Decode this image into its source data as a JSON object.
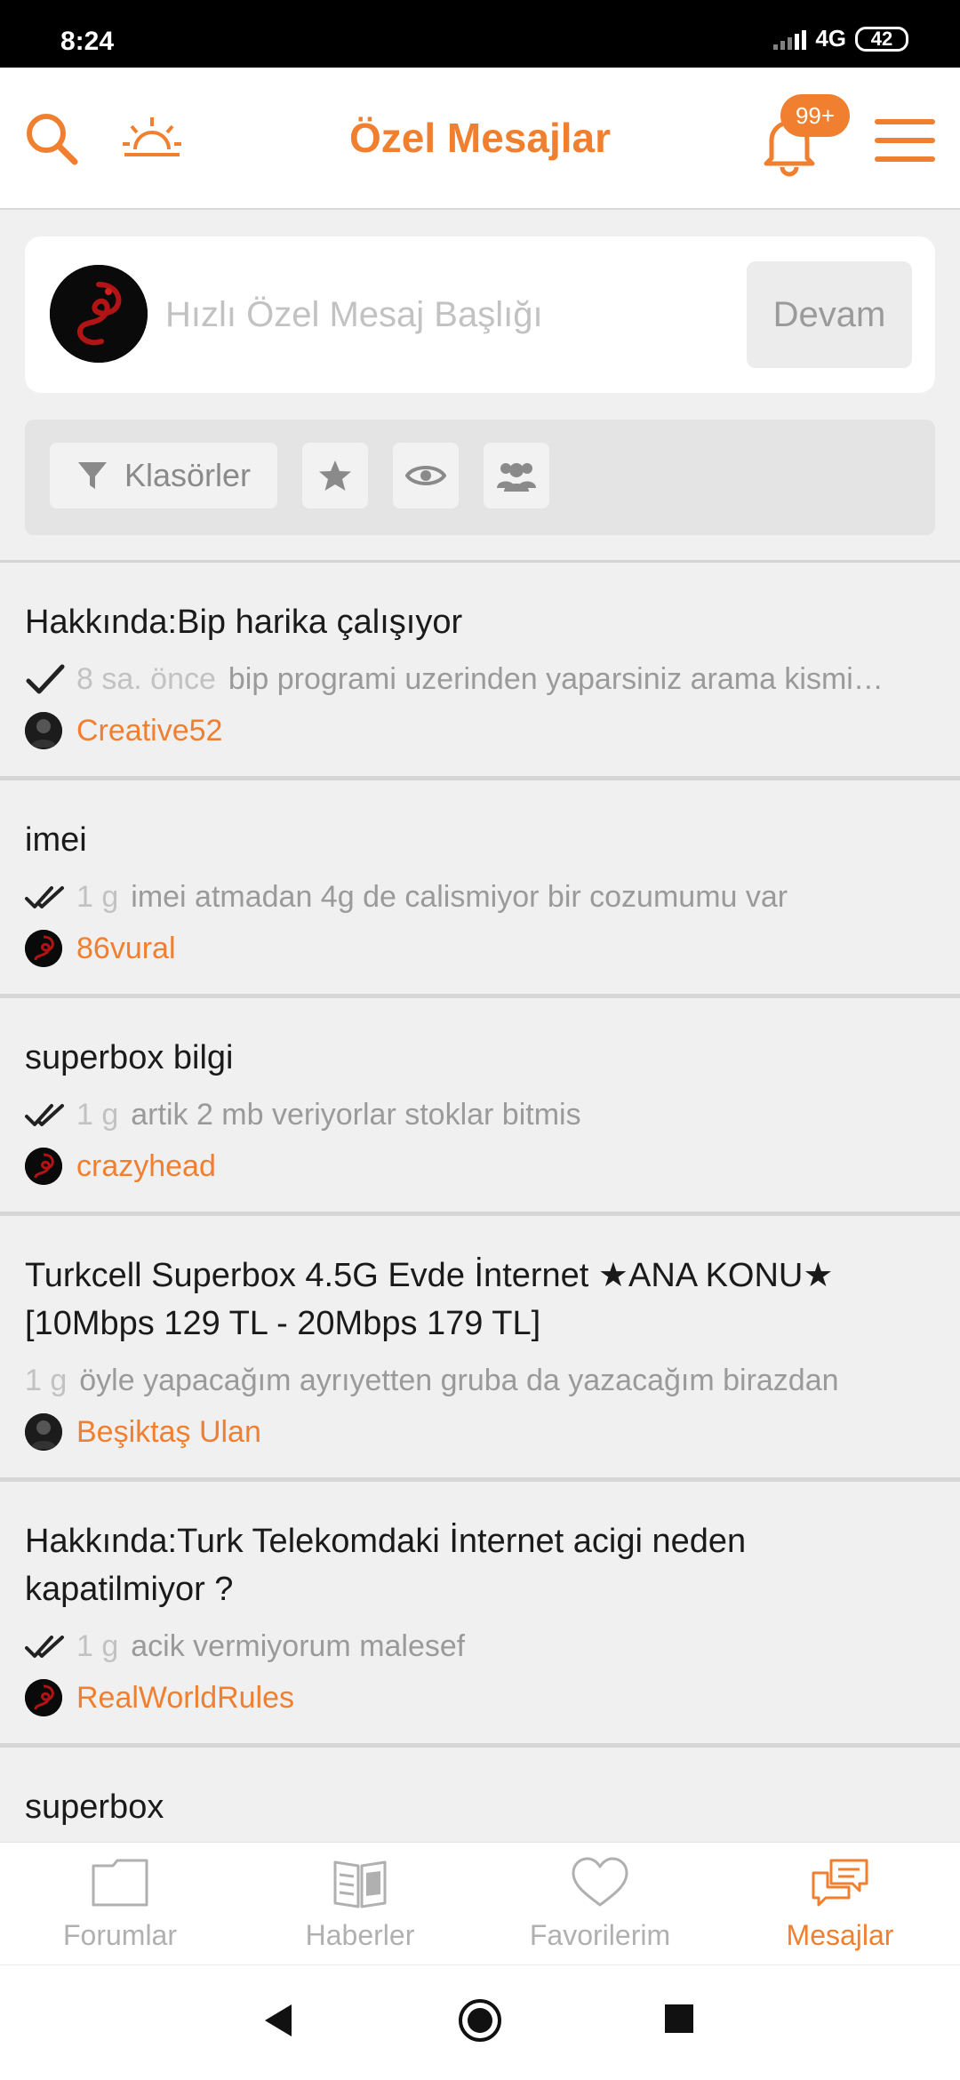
{
  "status_bar": {
    "time": "8:24",
    "network": "4G",
    "battery": "42"
  },
  "header": {
    "title": "Özel Mesajlar",
    "notification_badge": "99+"
  },
  "compose": {
    "placeholder": "Hızlı Özel Mesaj Başlığı",
    "continue_label": "Devam"
  },
  "filters": {
    "folders_label": "Klasörler"
  },
  "messages": [
    {
      "title": "Hakkında:Bip harika çalışıyor",
      "status": "sent",
      "time": "8 sa. önce",
      "preview": "bip programi uzerinden yaparsiniz arama kismi…",
      "author": "Creative52"
    },
    {
      "title": "imei",
      "status": "read",
      "time": "1 g",
      "preview": "imei atmadan 4g de calismiyor bir cozumumu var",
      "author": "86vural"
    },
    {
      "title": "superbox bilgi",
      "status": "read",
      "time": "1 g",
      "preview": "artik 2 mb veriyorlar stoklar bitmis",
      "author": "crazyhead"
    },
    {
      "title": "Turkcell Superbox 4.5G Evde İnternet ★ANA KONU★ [10Mbps 129 TL - 20Mbps 179 TL]",
      "status": "none",
      "time": "1 g",
      "preview": "öyle yapacağım ayrıyetten gruba da yazacağım birazdan",
      "author": "Beşiktaş Ulan"
    },
    {
      "title": "Hakkında:Turk Telekomdaki İnternet acigi neden kapatilmiyor ?",
      "status": "read",
      "time": "1 g",
      "preview": "acik vermiyorum malesef",
      "author": "RealWorldRules"
    },
    {
      "title": "superbox",
      "status": "none",
      "time": "",
      "preview": "",
      "author": ""
    }
  ],
  "bottom_nav": {
    "forums": "Forumlar",
    "news": "Haberler",
    "favorites": "Favorilerim",
    "messages": "Mesajlar"
  },
  "colors": {
    "accent": "#f07f2f",
    "text": "#1a1a1a",
    "muted": "#9a9a9a"
  }
}
